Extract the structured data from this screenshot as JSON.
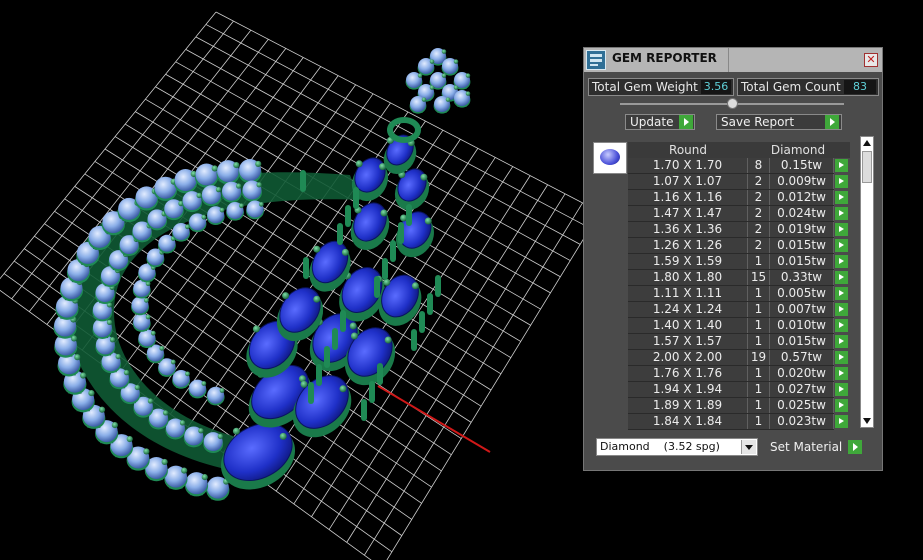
{
  "panel": {
    "title": "GEM REPORTER",
    "close_glyph": "✕",
    "icon": "gem-reporter-icon",
    "total_weight_label": "Total Gem Weight",
    "total_weight_value": "3.56",
    "total_count_label": "Total Gem Count",
    "total_count_value": "83",
    "update_label": "Update",
    "save_report_label": "Save Report",
    "table": {
      "shape_header": "Round",
      "material_header": "Diamond",
      "thumbnail_icon": "round-gem-icon",
      "rows": [
        {
          "size": "1.70 X 1.70",
          "count": "8",
          "weight": "0.15tw"
        },
        {
          "size": "1.07 X 1.07",
          "count": "2",
          "weight": "0.009tw"
        },
        {
          "size": "1.16 X 1.16",
          "count": "2",
          "weight": "0.012tw"
        },
        {
          "size": "1.47 X 1.47",
          "count": "2",
          "weight": "0.024tw"
        },
        {
          "size": "1.36 X 1.36",
          "count": "2",
          "weight": "0.019tw"
        },
        {
          "size": "1.26 X 1.26",
          "count": "2",
          "weight": "0.015tw"
        },
        {
          "size": "1.59 X 1.59",
          "count": "1",
          "weight": "0.015tw"
        },
        {
          "size": "1.80 X 1.80",
          "count": "15",
          "weight": "0.33tw"
        },
        {
          "size": "1.11 X 1.11",
          "count": "1",
          "weight": "0.005tw"
        },
        {
          "size": "1.24 X 1.24",
          "count": "1",
          "weight": "0.007tw"
        },
        {
          "size": "1.40 X 1.40",
          "count": "1",
          "weight": "0.010tw"
        },
        {
          "size": "1.57 X 1.57",
          "count": "1",
          "weight": "0.015tw"
        },
        {
          "size": "2.00 X 2.00",
          "count": "19",
          "weight": "0.57tw"
        },
        {
          "size": "1.76 X 1.76",
          "count": "1",
          "weight": "0.020tw"
        },
        {
          "size": "1.94 X 1.94",
          "count": "1",
          "weight": "0.027tw"
        },
        {
          "size": "1.89 X 1.89",
          "count": "1",
          "weight": "0.025tw"
        },
        {
          "size": "1.84 X 1.84",
          "count": "1",
          "weight": "0.023tw"
        }
      ]
    },
    "material_select": "Diamond    (3.52 spg)",
    "set_material_label": "Set Material"
  },
  "colors": {
    "background": "#000000",
    "grid": "#d0d0d0",
    "metal": "#1f8a55",
    "diamond": "#7fa2e0",
    "sapphire": "#1e2fb8",
    "accent_green": "#3fa83a",
    "value_cyan": "#5fd0d8"
  }
}
